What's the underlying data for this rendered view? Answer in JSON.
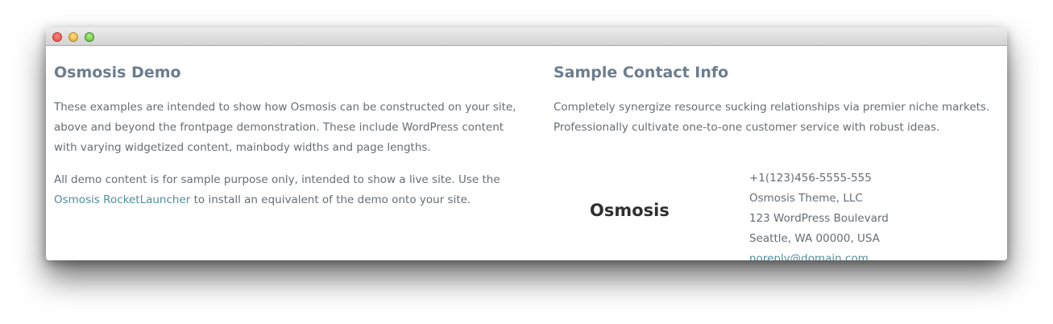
{
  "left": {
    "title": "Osmosis Demo",
    "p1": "These examples are intended to show how Osmosis can be constructed on your site, above and beyond the frontpage demonstration. These include WordPress content with varying widgetized content, mainbody widths and page lengths.",
    "p2_before": "All demo content is for sample purpose only, intended to show a live site. Use the ",
    "p2_link": "Osmosis RocketLauncher",
    "p2_after": " to install an equivalent of the demo onto your site."
  },
  "right": {
    "title": "Sample Contact Info",
    "intro": "Completely synergize resource sucking relationships via premier niche markets. Professionally cultivate one-to-one customer service with robust ideas.",
    "logo": "Osmosis",
    "phone": "+1(123)456-5555-555",
    "company": "Osmosis Theme, LLC",
    "street": "123 WordPress Boulevard",
    "city": "Seattle, WA 00000, USA",
    "email": "noreply@domain.com"
  },
  "colors": {
    "heading": "#6c7d8f",
    "body_text": "#666d73",
    "link": "#4e8f9c",
    "logo": "#2f2f2f"
  }
}
